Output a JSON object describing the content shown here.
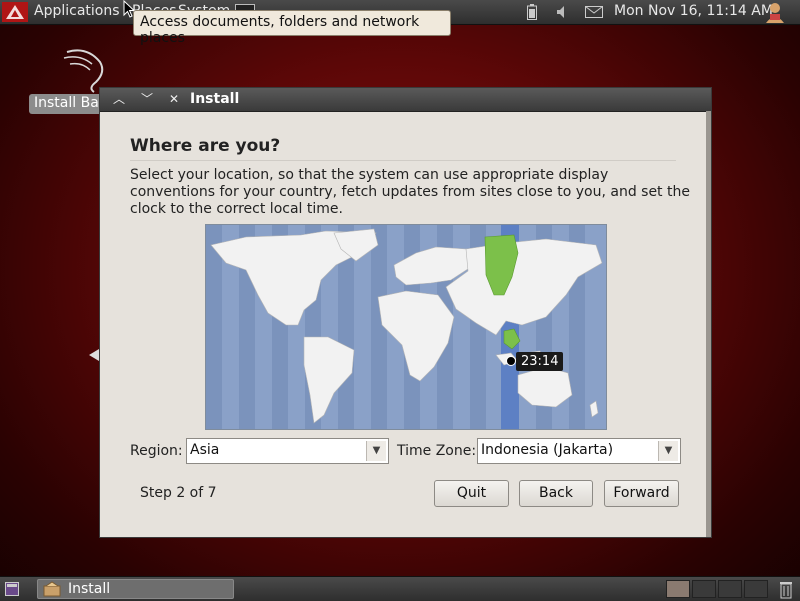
{
  "top_panel": {
    "applications": "Applications",
    "places": "Places",
    "system": "System",
    "clock": "Mon Nov 16, 11:14 AM"
  },
  "tooltip": "Access documents, folders and network places",
  "desktop": {
    "icon_label": "Install BackTrack"
  },
  "window": {
    "title": "Install",
    "heading": "Where are you?",
    "description": "Select your location, so that the system can use appropriate display conventions for your country, fetch updates from sites close to you, and set the clock to the correct local time.",
    "map_time": "23:14",
    "region_label": "Region:",
    "region_value": "Asia",
    "timezone_label": "Time Zone:",
    "timezone_value": "Indonesia (Jakarta)",
    "step": "Step 2 of 7",
    "quit": "Quit",
    "back": "Back",
    "forward": "Forward"
  },
  "taskbar": {
    "task_label": "Install"
  },
  "colors": {
    "desktop_red": "#8e1111",
    "map_ocean": "#8aa1c8",
    "land": "#f2f2f2",
    "highlight_land": "#7cc04a",
    "timezone_band": "#6a8cc8"
  }
}
